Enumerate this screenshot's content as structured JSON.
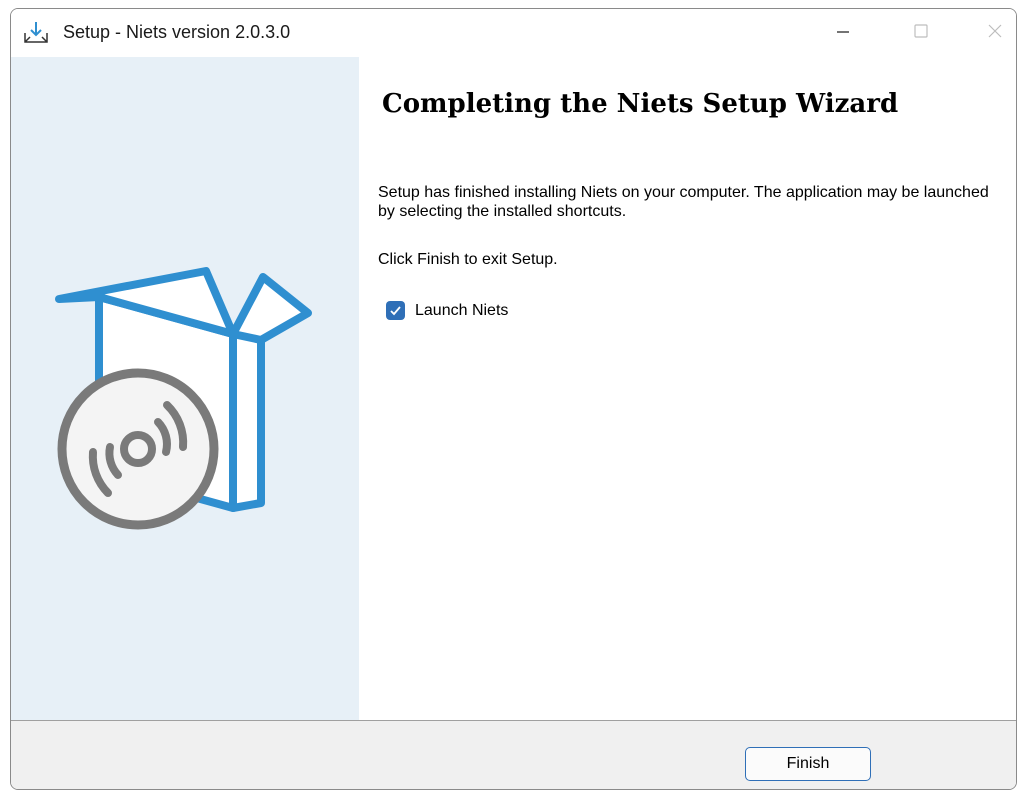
{
  "window": {
    "title": "Setup - Niets version 2.0.3.0",
    "icons": {
      "app": "installer-download-icon",
      "minimize": "minimize-icon",
      "maximize": "maximize-icon",
      "close": "close-icon"
    }
  },
  "sidebar": {
    "illustration": "box-with-disc-icon",
    "background": "#e7f0f7"
  },
  "content": {
    "heading": "Completing the Niets Setup Wizard",
    "paragraph_1": "Setup has finished installing Niets on your computer. The application may be launched by selecting the installed shortcuts.",
    "paragraph_2": "Click Finish to exit Setup.",
    "launch_checkbox": {
      "label": "Launch Niets",
      "checked": true
    }
  },
  "footer": {
    "finish_label": "Finish"
  },
  "colors": {
    "accent": "#2f6fb7",
    "illustration_blue": "#2f8fd0",
    "disc_gray": "#7a7a7a"
  }
}
